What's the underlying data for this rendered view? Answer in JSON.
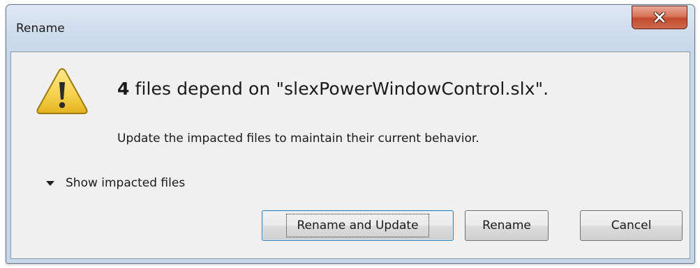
{
  "window": {
    "title": "Rename"
  },
  "dialog": {
    "icon": "warning-icon",
    "heading_count": "4",
    "heading_text": " files depend on \"slexPowerWindowControl.slx\".",
    "subtext": "Update the impacted files to maintain their current behavior.",
    "disclosure_label": "Show impacted files"
  },
  "buttons": {
    "rename_and_update": "Rename and Update",
    "rename": "Rename",
    "cancel": "Cancel"
  },
  "colors": {
    "close_button": "#c34a2c",
    "warning_fill": "#f5d04a",
    "client_background": "#f0f0f0",
    "default_button_border": "#3c7fb1"
  }
}
